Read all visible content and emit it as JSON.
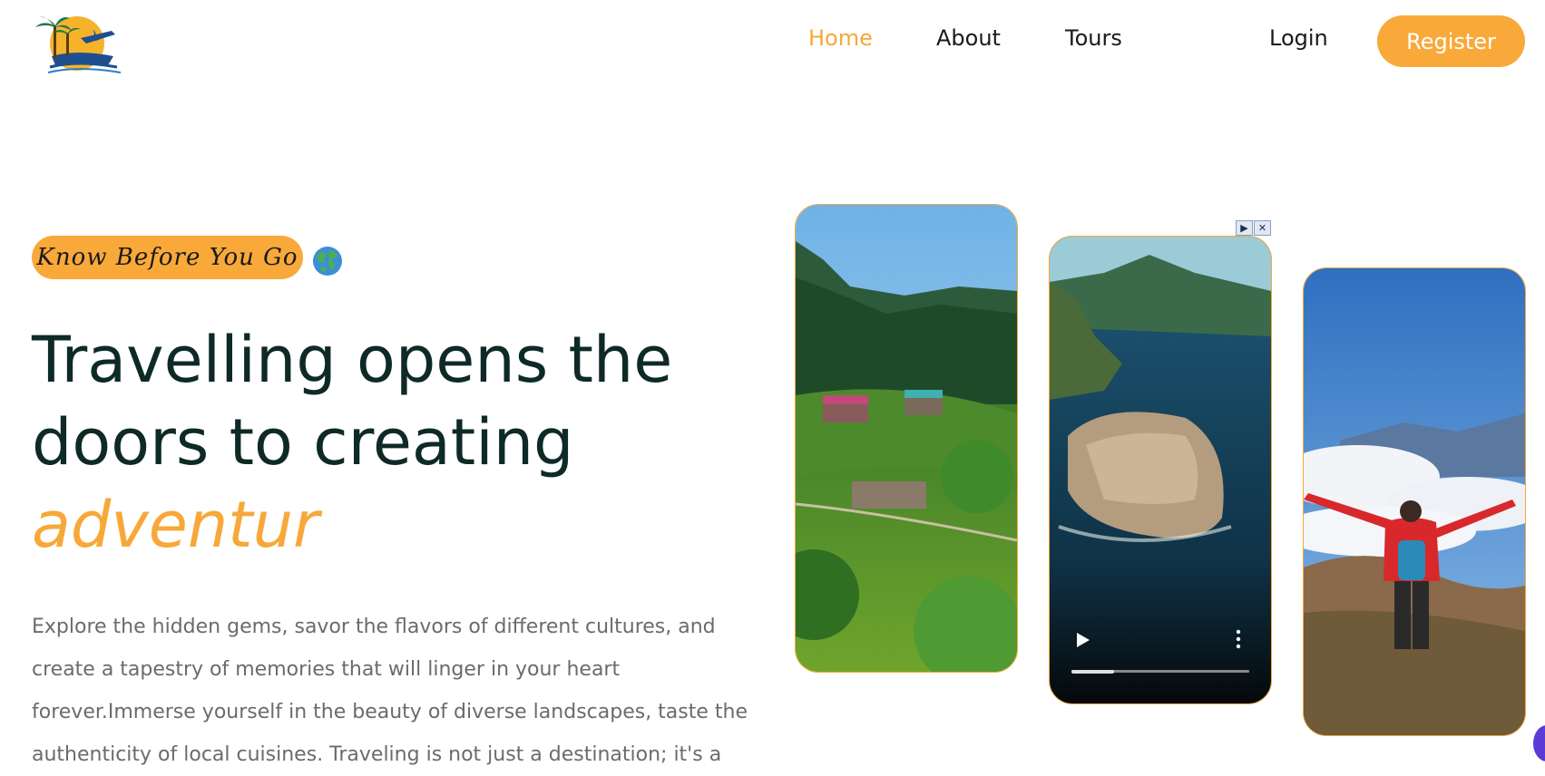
{
  "nav": {
    "home": "Home",
    "about": "About",
    "tours": "Tours",
    "login": "Login",
    "register": "Register"
  },
  "hero": {
    "badge": "Know Before You Go",
    "title_line1": "Travelling opens the",
    "title_line2": "doors to creating",
    "title_accent": "adventur",
    "description": "Explore the hidden gems, savor the flavors of different cultures, and create a tapestry of memories that will linger in your heart forever.Immerse yourself in the beauty of diverse landscapes, taste the authenticity of local cuisines. Traveling is not just a destination; it's a"
  },
  "video": {
    "progress": 0.24
  },
  "colors": {
    "accent": "#f9a93a",
    "heading": "#0e2a27",
    "text": "#6b6b6b"
  },
  "icons": [
    "logo-icon",
    "globe-icon",
    "play-icon",
    "more-options-icon",
    "ad-play-icon",
    "ad-close-icon"
  ]
}
